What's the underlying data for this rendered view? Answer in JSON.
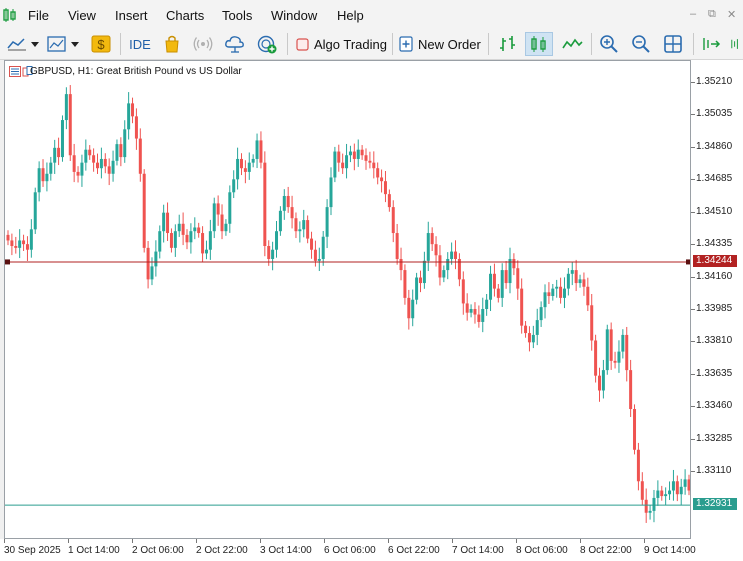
{
  "menu": {
    "items": [
      "File",
      "View",
      "Insert",
      "Charts",
      "Tools",
      "Window",
      "Help"
    ]
  },
  "window_controls": {
    "minimize": "–",
    "restore": "⧉",
    "close": "✕"
  },
  "toolbar": {
    "ide_label": "IDE",
    "algo_trading_label": "Algo Trading",
    "new_order_label": "New Order"
  },
  "chart": {
    "title": "GBPUSD, H1:  Great British Pound vs US Dollar",
    "bid_line_price": "1.34244",
    "current_price": "1.32931",
    "bid_line_color": "#b22222",
    "current_line_color": "#2a9d8f",
    "bull_color": "#26a69a",
    "bear_color": "#ef5350"
  },
  "price_axis": [
    "1.35210",
    "1.35035",
    "1.34860",
    "1.34685",
    "1.34510",
    "1.34335",
    "1.34160",
    "1.33985",
    "1.33810",
    "1.33635",
    "1.33460",
    "1.33285",
    "1.33110"
  ],
  "time_axis": [
    "30 Sep 2025",
    "1 Oct 14:00",
    "2 Oct 06:00",
    "2 Oct 22:00",
    "3 Oct 14:00",
    "6 Oct 06:00",
    "6 Oct 22:00",
    "7 Oct 14:00",
    "8 Oct 06:00",
    "8 Oct 22:00",
    "9 Oct 14:00"
  ],
  "chart_data": {
    "type": "candlestick",
    "symbol": "GBPUSD",
    "timeframe": "H1",
    "ylim": [
      1.3285,
      1.3542
    ],
    "closes": [
      1.3436,
      1.3433,
      1.3432,
      1.3436,
      1.3434,
      1.3431,
      1.3442,
      1.3462,
      1.3475,
      1.3468,
      1.3472,
      1.3478,
      1.3486,
      1.3481,
      1.3501,
      1.3515,
      1.3482,
      1.3473,
      1.3471,
      1.3478,
      1.3485,
      1.3482,
      1.3478,
      1.3475,
      1.348,
      1.3476,
      1.3472,
      1.3479,
      1.3488,
      1.3481,
      1.3496,
      1.351,
      1.3503,
      1.3491,
      1.3472,
      1.3432,
      1.3415,
      1.3422,
      1.343,
      1.3441,
      1.3451,
      1.344,
      1.3432,
      1.3441,
      1.3445,
      1.3439,
      1.3435,
      1.3441,
      1.3443,
      1.344,
      1.3429,
      1.3431,
      1.3441,
      1.3456,
      1.345,
      1.3441,
      1.3445,
      1.3462,
      1.3469,
      1.348,
      1.3475,
      1.3473,
      1.3478,
      1.348,
      1.349,
      1.3478,
      1.3433,
      1.3426,
      1.3431,
      1.3441,
      1.3452,
      1.346,
      1.3454,
      1.3448,
      1.3441,
      1.3442,
      1.3447,
      1.3437,
      1.3431,
      1.3425,
      1.3426,
      1.3438,
      1.3454,
      1.347,
      1.3484,
      1.3478,
      1.3475,
      1.3482,
      1.3484,
      1.348,
      1.3485,
      1.3482,
      1.3479,
      1.3478,
      1.3475,
      1.347,
      1.3468,
      1.3461,
      1.3454,
      1.344,
      1.3426,
      1.342,
      1.3405,
      1.3394,
      1.3404,
      1.3416,
      1.3413,
      1.3425,
      1.344,
      1.3434,
      1.3428,
      1.3416,
      1.342,
      1.3426,
      1.343,
      1.3426,
      1.3415,
      1.3402,
      1.3397,
      1.3399,
      1.3396,
      1.3392,
      1.3399,
      1.3404,
      1.3418,
      1.341,
      1.3405,
      1.342,
      1.3413,
      1.3426,
      1.3421,
      1.341,
      1.339,
      1.3386,
      1.3381,
      1.3385,
      1.3393,
      1.34,
      1.3408,
      1.3406,
      1.341,
      1.3411,
      1.3405,
      1.341,
      1.3418,
      1.342,
      1.3413,
      1.3415,
      1.3411,
      1.3401,
      1.3382,
      1.3363,
      1.3355,
      1.3366,
      1.3388,
      1.3371,
      1.337,
      1.3376,
      1.3385,
      1.3366,
      1.3345,
      1.3323,
      1.3306,
      1.3296,
      1.3289,
      1.329,
      1.3297,
      1.3301,
      1.3298,
      1.3299,
      1.3301,
      1.3306,
      1.3299,
      1.3303,
      1.3307,
      1.3301
    ],
    "bid_price": 1.34244,
    "current_price": 1.32931
  }
}
